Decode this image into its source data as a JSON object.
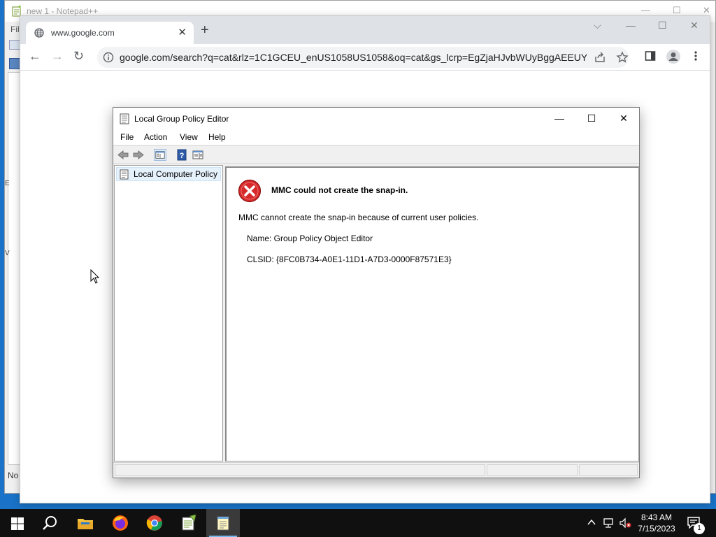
{
  "notepadpp": {
    "title": "new 1 - Notepad++",
    "menu_fragment": "Fil",
    "status_fragment": "No",
    "icon": "notepadpp-icon"
  },
  "chrome": {
    "tab_title": "www.google.com",
    "tab_close": "✕",
    "new_tab": "+",
    "url": "google.com/search?q=cat&rlz=1C1GCEU_enUS1058US1058&oq=cat&gs_lcrp=EgZjaHJvbWUyBggAEEUYO...",
    "icons": [
      "globe-icon",
      "back-icon",
      "forward-icon",
      "reload-icon",
      "info-icon",
      "share-icon",
      "star-icon",
      "side-panel-icon",
      "profile-icon",
      "menu-icon"
    ]
  },
  "mmc": {
    "title": "Local Group Policy Editor",
    "menu": {
      "file": "File",
      "action": "Action",
      "view": "View",
      "help": "Help"
    },
    "tree": {
      "root": "Local Computer Policy"
    },
    "error": {
      "title": "MMC could not create the snap-in.",
      "message": "MMC cannot create the snap-in because of current user policies.",
      "name_line": "Name: Group Policy Object Editor",
      "clsid_line": "CLSID: {8FC0B734-A0E1-11D1-A7D3-0000F87571E3}"
    },
    "colors": {
      "error_red": "#d62a2a",
      "selection": "#e5f1fb"
    }
  },
  "taskbar": {
    "apps": [
      "start-button",
      "search-button",
      "file-explorer",
      "firefox",
      "chrome",
      "notepadpp-taskbar",
      "notepad-taskbar"
    ],
    "clock_time": "8:43 AM",
    "clock_date": "7/15/2023",
    "notification_count": "1"
  }
}
